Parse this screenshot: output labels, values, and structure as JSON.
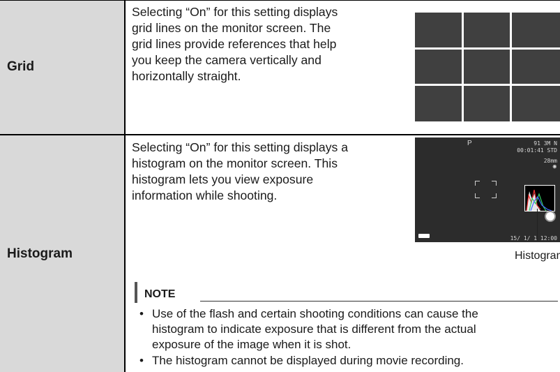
{
  "rows": [
    {
      "label": "Grid",
      "description": [
        "Selecting “On” for this setting displays",
        "grid lines on the monitor screen. The",
        "grid lines provide references that help",
        "you keep the camera vertically and",
        "horizontally straight."
      ]
    },
    {
      "label": "Histogram",
      "description": [
        "Selecting “On” for this setting displays a",
        "histogram on the monitor screen. This",
        "histogram lets you view exposure",
        "information while shooting."
      ],
      "monitor": {
        "mode": "P",
        "shots_size": "91 3M N",
        "time_quality": "00:01:41  STD",
        "focal": "28mm",
        "date": "15/ 1/ 1   12:00"
      },
      "callout_label": "Histogram",
      "note": {
        "title": "NOTE",
        "items": [
          [
            "Use of the flash and certain shooting conditions can cause the",
            "histogram to indicate exposure that is different from the actual",
            "exposure of the image when it is shot."
          ],
          [
            "The histogram cannot be displayed during movie recording."
          ]
        ],
        "bullet": "•"
      }
    }
  ],
  "colors": {
    "label_bg": "#d9d9d9",
    "monitor_bg": "#2c2c2c",
    "grid_bg": "#404040"
  }
}
